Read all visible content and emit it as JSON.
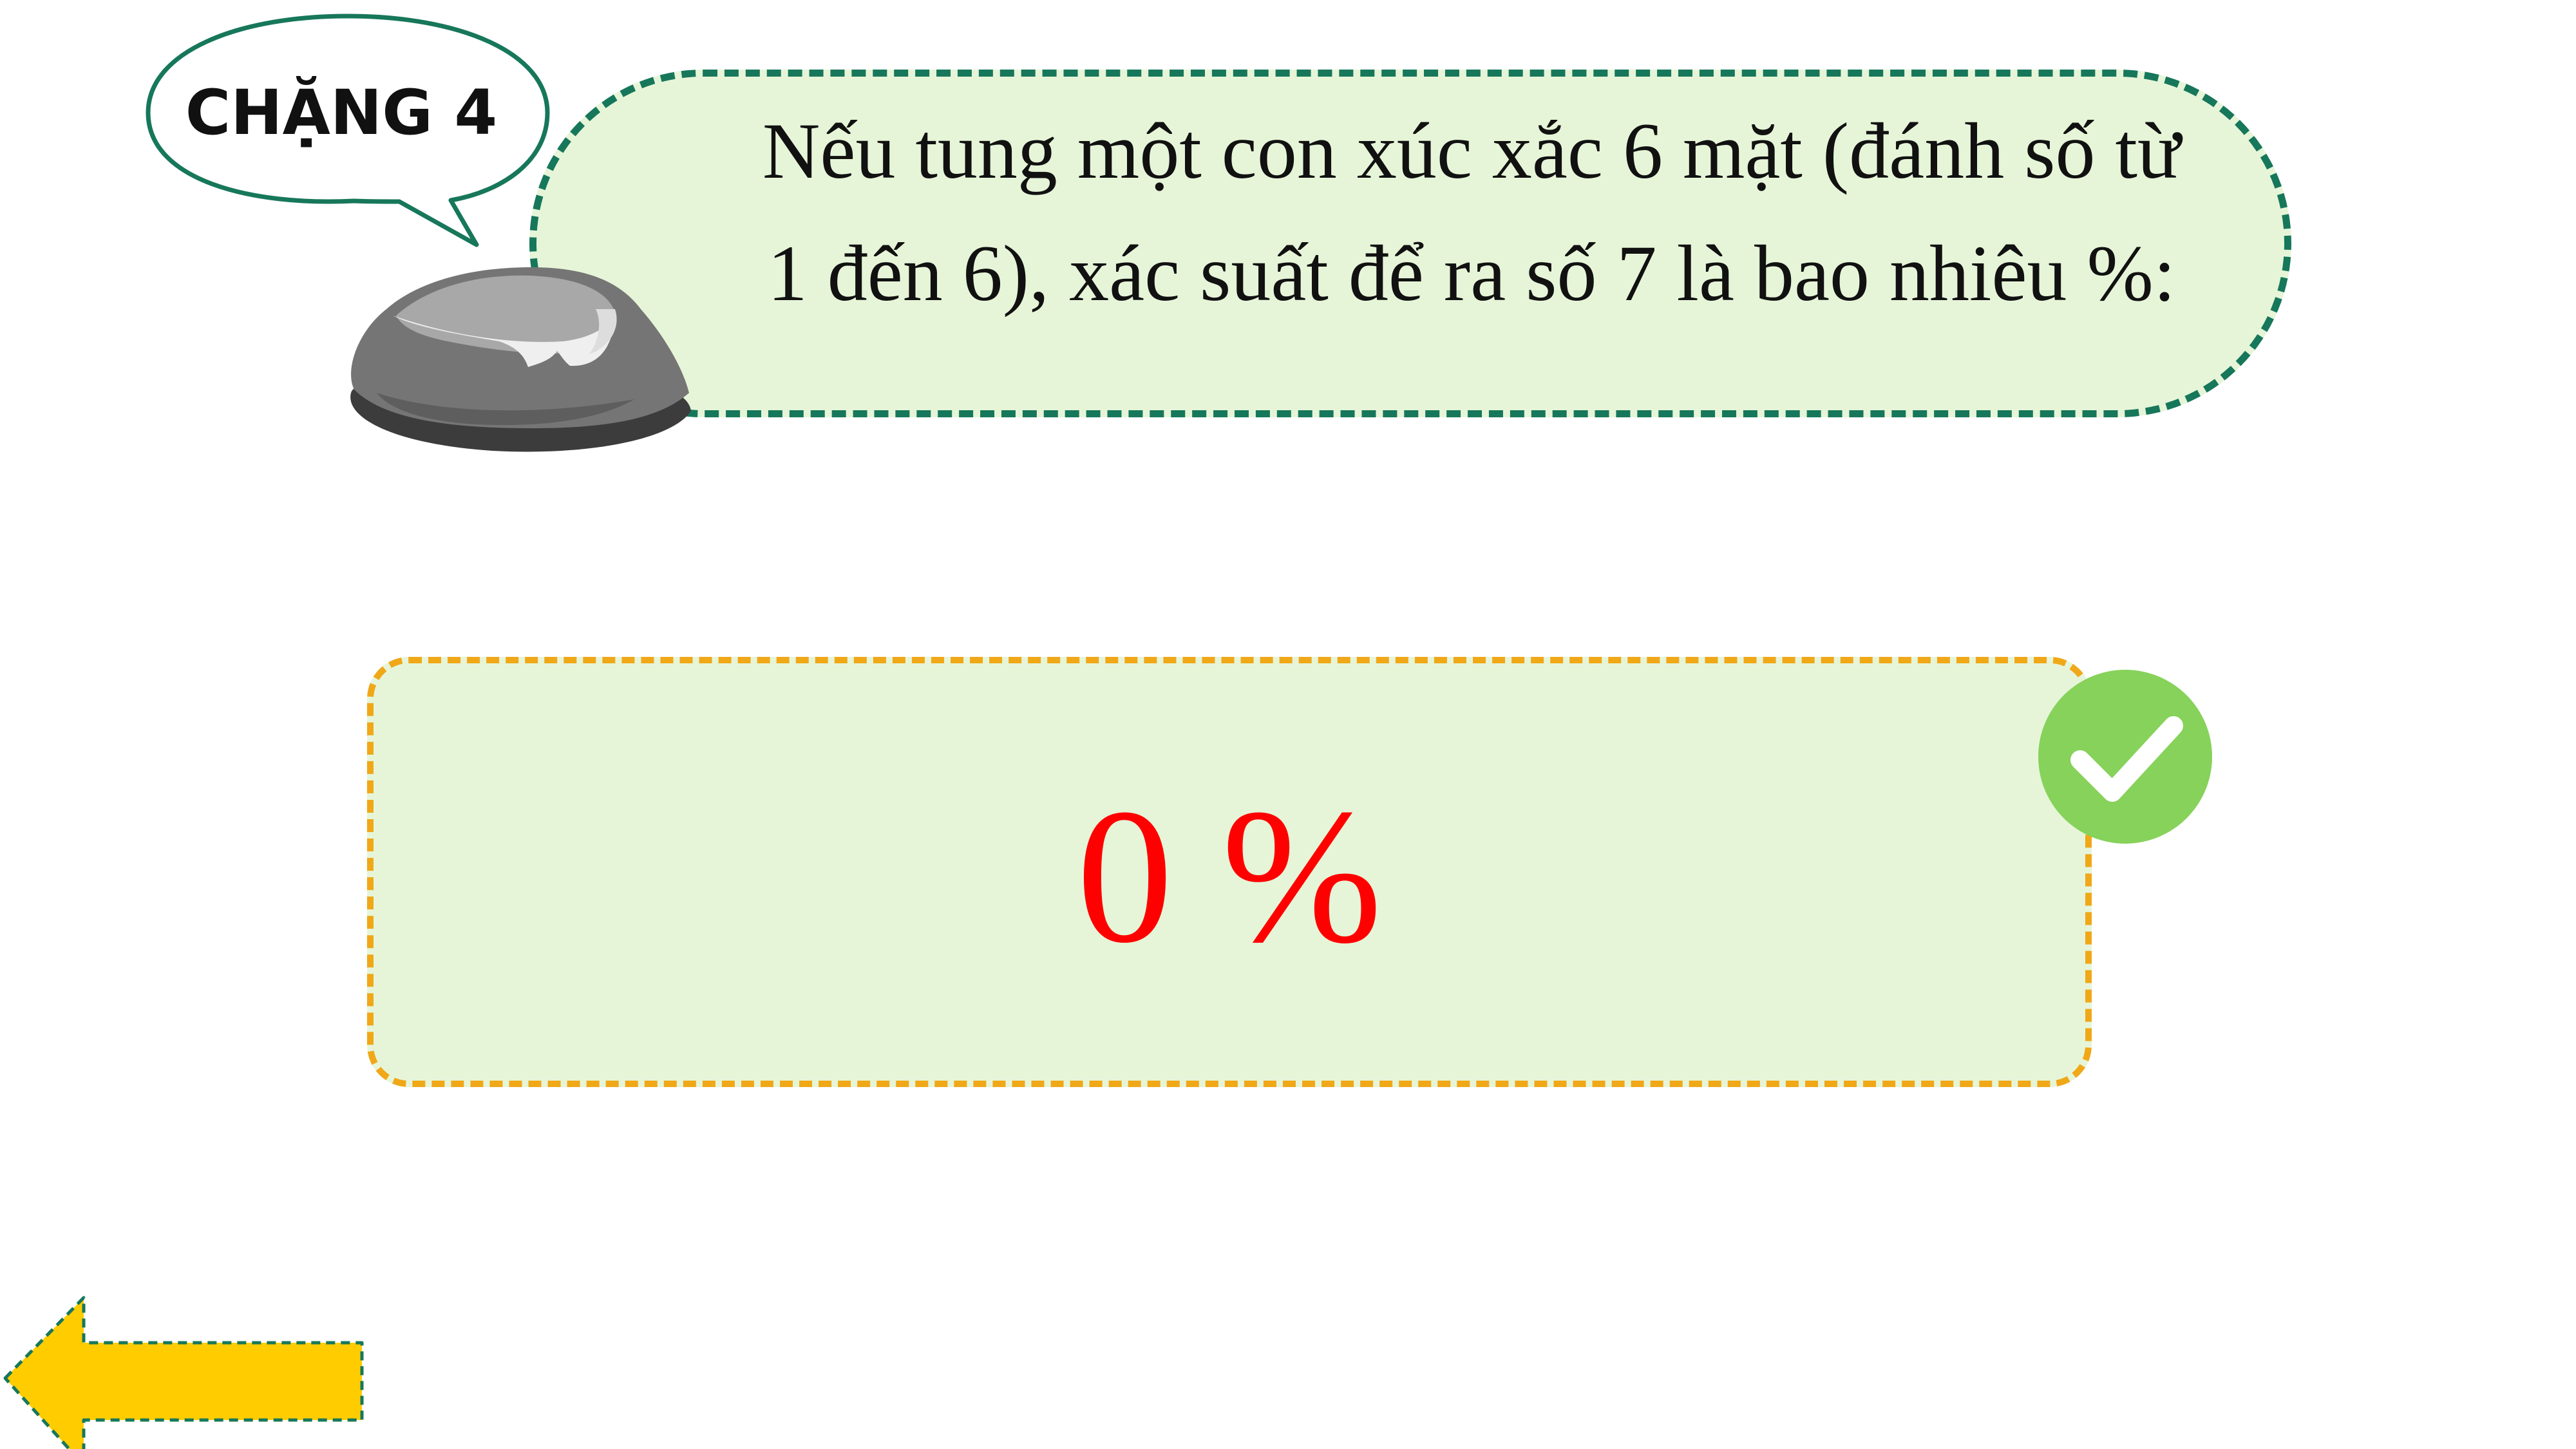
{
  "stage_label": "CHẶNG 4",
  "question": {
    "line1": "Nếu tung một con xúc xắc 6 mặt (đánh số từ",
    "line2": "1 đến 6), xác suất để ra số 7 là bao nhiêu %:"
  },
  "answer": {
    "value": "0 %",
    "status": "correct"
  },
  "icons": {
    "check": "check-circle-icon",
    "back": "arrow-left-icon",
    "rock": "rock-icon"
  },
  "colors": {
    "bubble_fill": "#e6f5d8",
    "bubble_border": "#17775a",
    "answer_border": "#f0a818",
    "answer_text": "#ff0000",
    "check_green": "#86d25a",
    "arrow_yellow": "#ffcc00",
    "arrow_outline": "#17775a"
  }
}
